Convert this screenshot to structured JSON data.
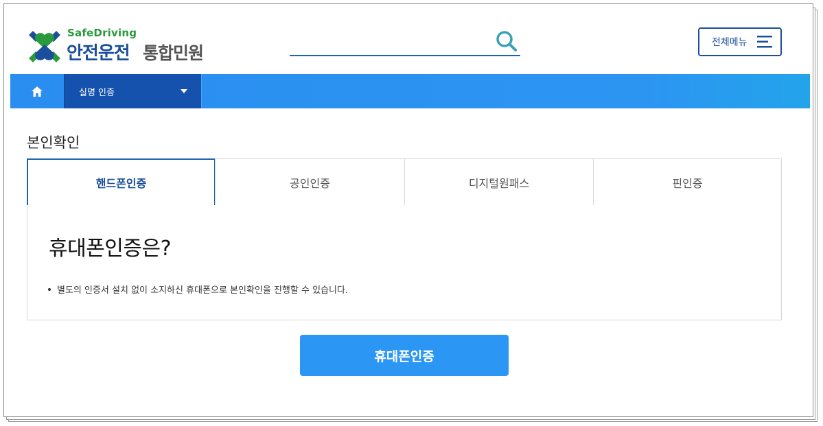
{
  "header": {
    "logo_sub": "SafeDriving",
    "logo_main": "안전운전",
    "logo_main2": "통합민원",
    "search": {
      "value": "",
      "placeholder": "",
      "icon": "search-icon"
    },
    "menu_button_label": "전체메뉴",
    "menu_icon": "hamburger-menu-icon"
  },
  "navbar": {
    "home_icon": "home-icon",
    "breadcrumb_label": "실명 인증",
    "breadcrumb_icon": "caret-down-icon"
  },
  "content": {
    "section_title": "본인확인",
    "tabs": [
      {
        "label": "핸드폰인증",
        "active": true
      },
      {
        "label": "공인인증",
        "active": false
      },
      {
        "label": "디지털원패스",
        "active": false
      },
      {
        "label": "핀인증",
        "active": false
      }
    ],
    "panel_title": "휴대폰인증은?",
    "panel_bullets": [
      "별도의 인증서 설치 없이 소지하신 휴대폰으로 본인확인을 진행할 수 있습니다."
    ],
    "cta_label": "휴대폰인증"
  },
  "colors": {
    "brand_blue": "#1b4f9c",
    "nav_blue": "#2c95f2",
    "crumb_blue": "#1552ad",
    "logo_green": "#2a9a3c",
    "cta_blue": "#2b96f3"
  }
}
